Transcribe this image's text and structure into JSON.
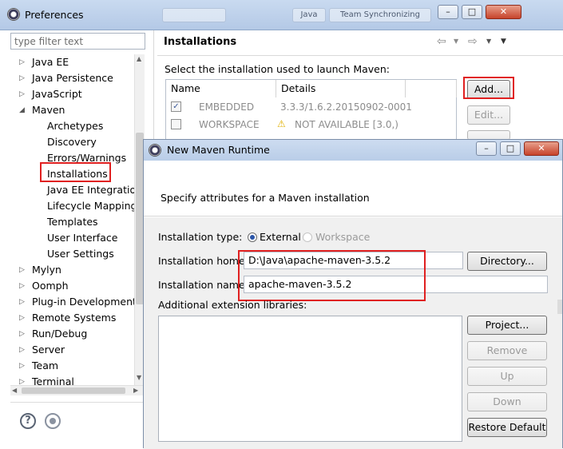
{
  "preferences": {
    "title": "Preferences",
    "filter_placeholder": "type filter text",
    "page_title": "Installations",
    "select_label": "Select the installation used to launch Maven:",
    "table": {
      "columns": [
        "Name",
        "Details"
      ],
      "rows": [
        {
          "checked": true,
          "name": "EMBEDDED",
          "details": "3.3.3/1.6.2.20150902-0001"
        },
        {
          "checked": false,
          "name": "WORKSPACE",
          "details": "NOT AVAILABLE [3.0,)"
        }
      ]
    },
    "buttons": {
      "add": "Add...",
      "edit": "Edit..."
    },
    "tree": [
      {
        "label": "Java EE",
        "level": 0,
        "arrow": "collapsed"
      },
      {
        "label": "Java Persistence",
        "level": 0,
        "arrow": "collapsed"
      },
      {
        "label": "JavaScript",
        "level": 0,
        "arrow": "collapsed"
      },
      {
        "label": "Maven",
        "level": 0,
        "arrow": "expanded"
      },
      {
        "label": "Archetypes",
        "level": 1,
        "arrow": "none"
      },
      {
        "label": "Discovery",
        "level": 1,
        "arrow": "none"
      },
      {
        "label": "Errors/Warnings",
        "level": 1,
        "arrow": "none"
      },
      {
        "label": "Installations",
        "level": 1,
        "arrow": "none"
      },
      {
        "label": "Java EE Integration",
        "level": 1,
        "arrow": "none"
      },
      {
        "label": "Lifecycle Mapping",
        "level": 1,
        "arrow": "none"
      },
      {
        "label": "Templates",
        "level": 1,
        "arrow": "none"
      },
      {
        "label": "User Interface",
        "level": 1,
        "arrow": "none"
      },
      {
        "label": "User Settings",
        "level": 1,
        "arrow": "none"
      },
      {
        "label": "Mylyn",
        "level": 0,
        "arrow": "collapsed"
      },
      {
        "label": "Oomph",
        "level": 0,
        "arrow": "collapsed"
      },
      {
        "label": "Plug-in Development",
        "level": 0,
        "arrow": "collapsed"
      },
      {
        "label": "Remote Systems",
        "level": 0,
        "arrow": "collapsed"
      },
      {
        "label": "Run/Debug",
        "level": 0,
        "arrow": "collapsed"
      },
      {
        "label": "Server",
        "level": 0,
        "arrow": "collapsed"
      },
      {
        "label": "Team",
        "level": 0,
        "arrow": "collapsed"
      },
      {
        "label": "Terminal",
        "level": 0,
        "arrow": "collapsed"
      }
    ],
    "help_icon_glyph": "?",
    "background_tabs": {
      "java": "Java",
      "team_sync": "Team Synchronizing"
    }
  },
  "dialog": {
    "title": "New Maven Runtime",
    "description": "Specify attributes for a Maven installation",
    "installation_type_label": "Installation type:",
    "type_options": {
      "external": "External",
      "workspace": "Workspace"
    },
    "selected_type": "External",
    "home_label": "Installation home:",
    "home_value": "D:\\Java\\apache-maven-3.5.2",
    "name_label": "Installation name:",
    "name_value": "apache-maven-3.5.2",
    "ext_label": "Additional extension libraries:",
    "buttons": {
      "directory": "Directory...",
      "project": "Project...",
      "remove": "Remove",
      "up": "Up",
      "down": "Down",
      "restore": "Restore Default"
    }
  },
  "colors": {
    "highlight": "#e02020",
    "title_bar": "#c4d6ee",
    "warning": "#e0b000"
  }
}
